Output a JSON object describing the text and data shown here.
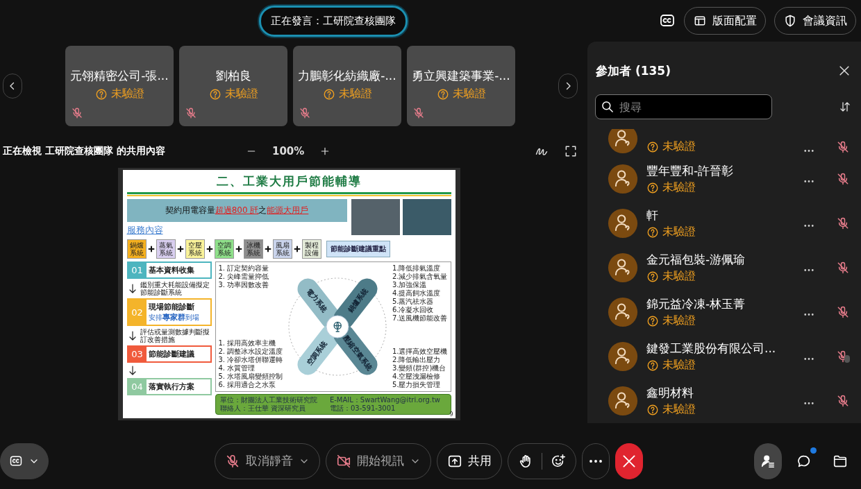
{
  "speaker_banner": {
    "text": "正在發言：工研院查核團隊"
  },
  "top_buttons": [
    {
      "kind": "captions"
    },
    {
      "kind": "layout",
      "label": "版面配置"
    },
    {
      "kind": "info",
      "label": "會議資訊"
    }
  ],
  "video_strip": {
    "tiles": [
      {
        "name": "元翎精密公司-張...",
        "status": "未驗證",
        "muted": true
      },
      {
        "name": "劉柏良",
        "status": "未驗證",
        "muted": true
      },
      {
        "name": "力鵬彰化紡織廠-...",
        "status": "未驗證",
        "muted": true
      },
      {
        "name": "勇立興建築事業-...",
        "status": "未驗證",
        "muted": true
      }
    ]
  },
  "share_header": {
    "text": "正在檢視 工研院查核團隊 的共用內容",
    "zoom": "100%"
  },
  "slide": {
    "title": "二、工業大用戶節能輔導",
    "banner": [
      {
        "text": "契約用電容量",
        "highlight": false
      },
      {
        "text": "超過800 瓩",
        "highlight": true
      },
      {
        "text": "之",
        "highlight": false
      },
      {
        "text": "能源大用戶",
        "highlight": true
      }
    ],
    "section_heading": "服務內容",
    "systems": [
      {
        "label": "鍋爐系統",
        "color": "#f5b01e"
      },
      {
        "label": "蒸氣系統",
        "color": "#d9cff0"
      },
      {
        "label": "空壓系統",
        "color": "#faf39a"
      },
      {
        "label": "空調系統",
        "color": "#8fe08a"
      },
      {
        "label": "冰機系統",
        "color": "#8e8e8e"
      },
      {
        "label": "風扇系統",
        "color": "#cad4ec"
      },
      {
        "label": "製程設備",
        "color": "#e4ebd9"
      }
    ],
    "focus_label": "節能診斷建議重點",
    "steps": [
      {
        "number": "01",
        "label": "基本資料收集",
        "color": "#4db5bf",
        "note": "鑑別重大耗能設備擬定節能診斷系統"
      },
      {
        "number": "02",
        "label": "現場節能診斷",
        "sub": "安排**專家群**到場",
        "color": "#f4b42a",
        "note": "評估或量測數據判斷擬訂改善措施"
      },
      {
        "number": "03",
        "label": "節能診斷建議",
        "color": "#f05a3c"
      },
      {
        "number": "04",
        "label": "落實執行方案",
        "color": "#8fc9a0"
      }
    ],
    "diagram": {
      "arms": [
        {
          "label": "電力系統",
          "color": "#93bcc6",
          "items": [
            "1. 訂定契約容量",
            "2. 尖峰需量抑低",
            "3. 功率因數改善"
          ]
        },
        {
          "label": "鍋爐系統",
          "color": "#4d7b88",
          "items": [
            "1.降低排氣溫度",
            "2.減少排氣含氧量",
            "3.加強保溫",
            "4.提高飼水溫度",
            "5.蒸汽祛水器",
            "6.冷凝水回收",
            "7.送風機節能改善"
          ]
        },
        {
          "label": "空調系統",
          "color": "#a9cfd8",
          "items": [
            "1. 採用高效率主機",
            "2. 調整冰水設定溫度",
            "3. 冷卻水塔併聯運轉",
            "4. 水質管理",
            "5. 水塔風扇變頻控制",
            "6. 採用適合之水泵"
          ]
        },
        {
          "label": "壓縮空氣系統",
          "color": "#5a8794",
          "items": [
            "1.選擇高效空壓機",
            "2.降低輸出壓力",
            "3.變頻(群控)機台",
            "4.空壓洩漏檢修",
            "5.壓力損失管理"
          ]
        }
      ]
    },
    "footer": [
      "單位：財團法人工業技術研究院",
      "E-MAIL：SwartWang@itri.org.tw",
      "聯絡人：王仕華 資深研究員",
      "電話：03-591-3001"
    ],
    "page_number": "9"
  },
  "participants_panel": {
    "title": "參加者 (135)",
    "search_placeholder": "搜尋",
    "participants": [
      {
        "status": "未驗證",
        "muted": true
      },
      {
        "name": "豐年豐和-許晉彰",
        "status": "未驗證",
        "muted": true
      },
      {
        "name": "軒",
        "status": "未驗證",
        "muted": true
      },
      {
        "name": "金元福包裝-游佩瑜",
        "status": "未驗證",
        "muted": true
      },
      {
        "name": "錦元益冷凍-林玉菁",
        "status": "未驗證",
        "muted": true
      },
      {
        "name": "鍵發工業股份有限公司...",
        "status": "未驗證",
        "muted": true
      },
      {
        "name": "鑫明材料",
        "status": "未驗證",
        "muted": true
      }
    ]
  },
  "bottom_bar": {
    "left": [
      {
        "kind": "captions"
      }
    ],
    "center": [
      {
        "kind": "mute",
        "label": "取消靜音"
      },
      {
        "kind": "video",
        "label": "開始視訊"
      },
      {
        "kind": "share",
        "label": "共用"
      },
      {
        "kind": "reactions"
      },
      {
        "kind": "more"
      },
      {
        "kind": "leave"
      }
    ],
    "right": [
      {
        "kind": "participants",
        "selected": true,
        "unread": false
      },
      {
        "kind": "chat",
        "selected": false,
        "unread": true
      },
      {
        "kind": "files",
        "selected": false,
        "unread": false
      }
    ]
  }
}
